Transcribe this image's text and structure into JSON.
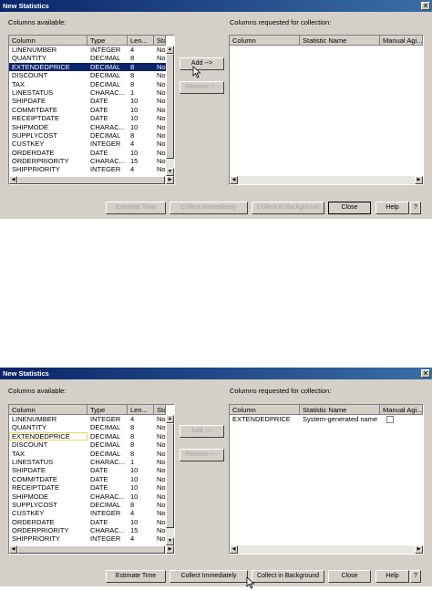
{
  "dialog": {
    "title": "New Statistics",
    "close_glyph": "✕",
    "columns_available_label": "Columns available:",
    "columns_requested_label": "Columns requested for collection:"
  },
  "available_headers": [
    "Column",
    "Type",
    "Len...",
    "Sta"
  ],
  "available_rows": [
    [
      "LINENUMBER",
      "INTEGER",
      "4",
      "No"
    ],
    [
      "QUANTITY",
      "DECIMAL",
      "8",
      "No"
    ],
    [
      "EXTENDEDPRICE",
      "DECIMAL",
      "8",
      "No"
    ],
    [
      "DISCOUNT",
      "DECIMAL",
      "8",
      "No"
    ],
    [
      "TAX",
      "DECIMAL",
      "8",
      "No"
    ],
    [
      "LINESTATUS",
      "CHARAC...",
      "1",
      "No"
    ],
    [
      "SHIPDATE",
      "DATE",
      "10",
      "No"
    ],
    [
      "COMMITDATE",
      "DATE",
      "10",
      "No"
    ],
    [
      "RECEIPTDATE",
      "DATE",
      "10",
      "No"
    ],
    [
      "SHIPMODE",
      "CHARAC...",
      "10",
      "No"
    ],
    [
      "SUPPLYCOST",
      "DECIMAL",
      "8",
      "No"
    ],
    [
      "CUSTKEY",
      "INTEGER",
      "4",
      "No"
    ],
    [
      "ORDERDATE",
      "DATE",
      "10",
      "No"
    ],
    [
      "ORDERPRIORITY",
      "CHARAC...",
      "15",
      "No"
    ],
    [
      "SHIPPRIORITY",
      "INTEGER",
      "4",
      "No"
    ]
  ],
  "requested_headers": [
    "Column",
    "Statistic Name",
    "Manual Agi..."
  ],
  "requested_rows_after": [
    [
      "EXTENDEDPRICE",
      "System-generated name",
      ""
    ]
  ],
  "buttons": {
    "add": "Add -->",
    "remove": "Remove <--",
    "estimate": "Estimate Time",
    "collect_now": "Collect Immediately",
    "collect_bg": "Collect in Background",
    "close": "Close",
    "help": "Help",
    "question": "?"
  },
  "icons": {
    "close": "close-icon",
    "arrow_up": "scroll-up-arrow-icon",
    "arrow_down": "scroll-down-arrow-icon",
    "arrow_left": "scroll-left-arrow-icon",
    "arrow_right": "scroll-right-arrow-icon",
    "cursor": "mouse-pointer-icon"
  },
  "colors": {
    "window_bg": "#d4d0c8",
    "titlebar": "#0a246a",
    "selection": "#0a246a"
  }
}
